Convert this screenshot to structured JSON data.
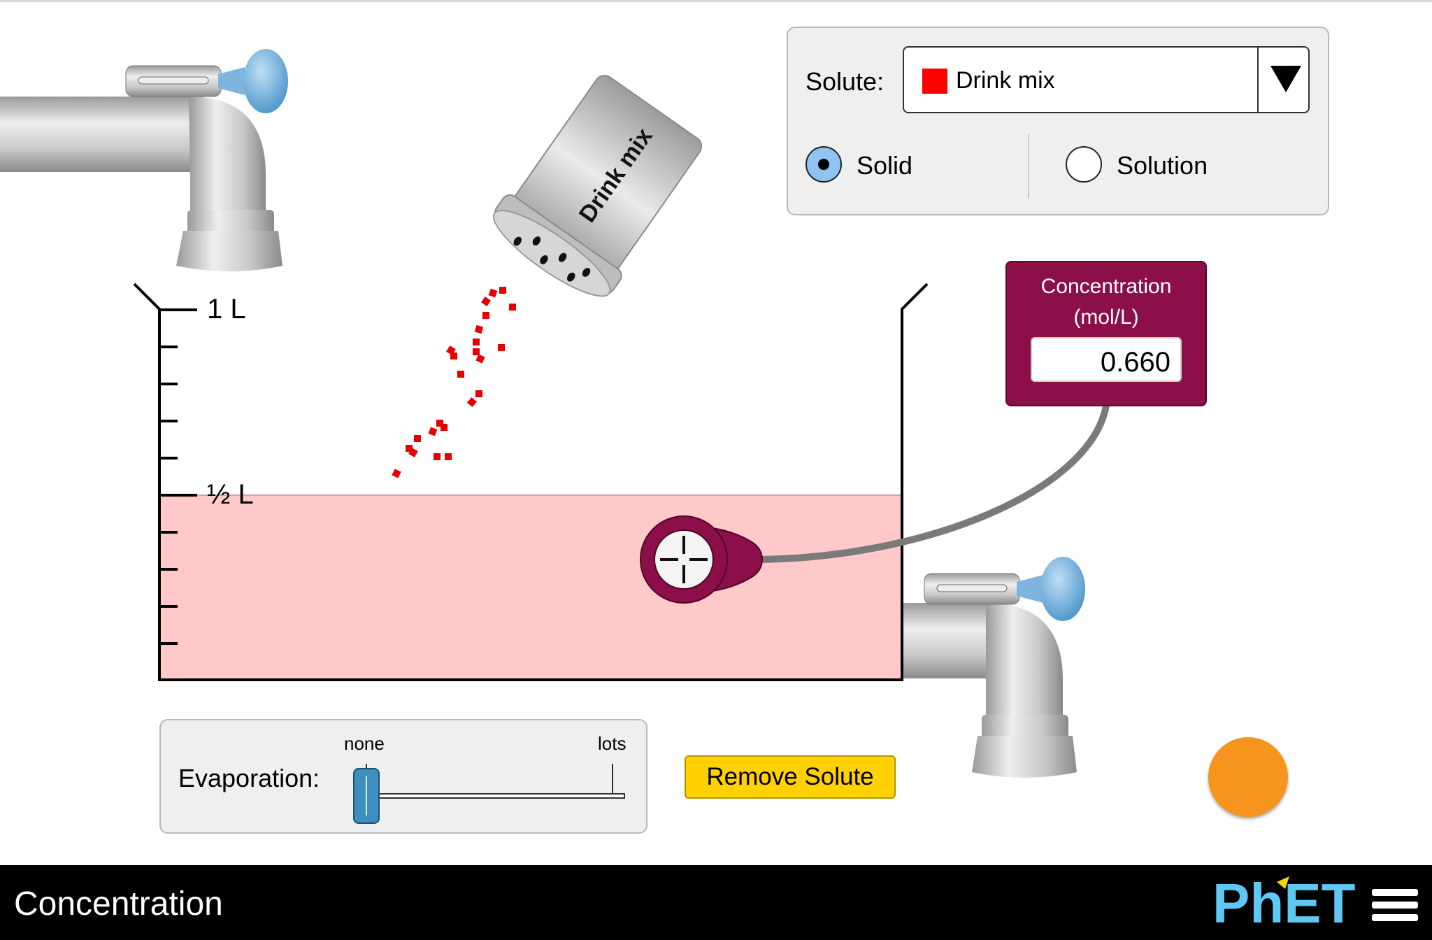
{
  "solute_panel": {
    "label": "Solute:",
    "selected": "Drink mix",
    "selected_color": "#ff0000",
    "options": [
      {
        "label": "Solid",
        "selected": true
      },
      {
        "label": "Solution",
        "selected": false
      }
    ]
  },
  "shaker": {
    "label": "Drink mix"
  },
  "beaker": {
    "tick_labels": [
      "1 L",
      "½ L"
    ],
    "solution_color": "#ffc9c9"
  },
  "meter": {
    "title_line1": "Concentration",
    "title_line2": "(mol/L)",
    "value": "0.660",
    "body_color": "#8c0f49"
  },
  "evaporation": {
    "label": "Evaporation:",
    "min_label": "none",
    "max_label": "lots",
    "level": 0
  },
  "remove_button": {
    "label": "Remove Solute"
  },
  "navbar": {
    "title": "Concentration",
    "logo_text": "PhET"
  }
}
